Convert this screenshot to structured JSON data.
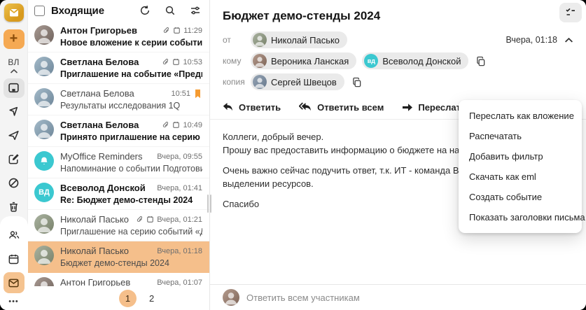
{
  "sidebar": {
    "plus": "+",
    "initials": "ВЛ",
    "more": "•••"
  },
  "list": {
    "title": "Входящие",
    "items": [
      {
        "name": "Антон Григорьев",
        "subject": "Новое вложение к серии событий «Аналити…",
        "time": "11:29"
      },
      {
        "name": "Светлана Белова",
        "subject": "Приглашение на событие «Предварительно…",
        "time": "10:53"
      },
      {
        "name": "Светлана Белова",
        "subject": "Результаты исследования 1Q",
        "time": "10:51"
      },
      {
        "name": "Светлана Белова",
        "subject": "Принято приглашение на серию событий «…",
        "time": "10:49"
      },
      {
        "name": "MyOffice Reminders",
        "subject": "Напоминание о событии Подготовить отчет…",
        "time": "Вчера, 09:55"
      },
      {
        "name": "Всеволод Донской",
        "subject": "Re: Бюджет демо-стенды 2024",
        "time": "Вчера, 01:41",
        "avatar_initials": "ВД"
      },
      {
        "name": "Николай Пасько",
        "subject": "Приглашение на серию событий «Демо стен…",
        "time": "Вчера, 01:21"
      },
      {
        "name": "Николай Пасько",
        "subject": "Бюджет демо-стенды 2024",
        "time": "Вчера, 01:18"
      },
      {
        "name": "Антон Григорьев",
        "subject": "",
        "time": "Вчера, 01:07"
      }
    ],
    "pagination": {
      "page1": "1",
      "page2": "2"
    }
  },
  "reader": {
    "subject": "Бюджет демо-стенды 2024",
    "timestamp": "Вчера, 01:18",
    "meta": {
      "from_label": "от",
      "from_name": "Николай Пасько",
      "to_label": "кому",
      "to1": "Вероника Ланская",
      "to2_initials": "вд",
      "to2": "Всеволод Донской",
      "cc_label": "копия",
      "cc1": "Сергей Швецов"
    },
    "toolbar": {
      "reply": "Ответить",
      "reply_all": "Ответить всем",
      "forward": "Переслать"
    },
    "body": [
      "Коллеги, добрый вечер.",
      "Прошу вас предоставить информацию о бюджете на наши демонстраци",
      "",
      "Очень важно сейчас подучить ответ, т.к. ИТ - команда Всеволода, уже",
      "выделении ресурсов.",
      "",
      "Спасибо"
    ],
    "quick_reply": "Ответить всем участникам"
  },
  "menu": {
    "items": [
      "Переслать как вложение",
      "Распечатать",
      "Добавить фильтр",
      "Скачать как eml",
      "Создать событие",
      "Показать заголовки письма"
    ]
  },
  "colors": {
    "accent_orange": "#f5a953",
    "selected_row": "#f5bf8b",
    "teal": "#3bc8d0"
  }
}
